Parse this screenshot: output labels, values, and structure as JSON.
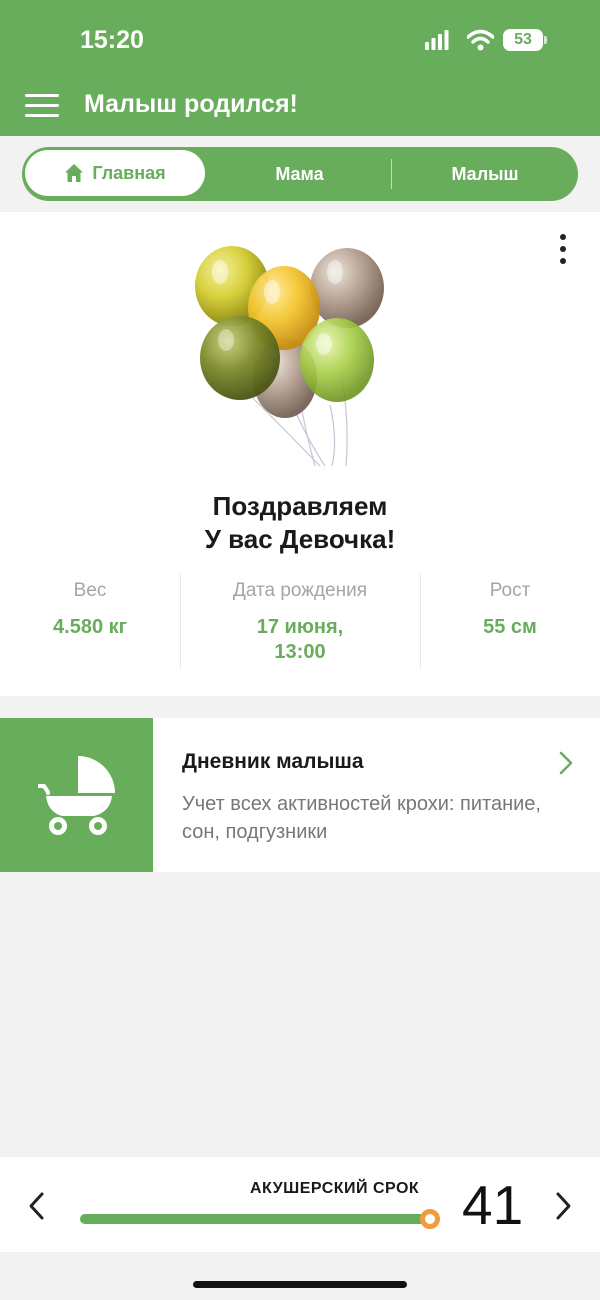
{
  "status_bar": {
    "time": "15:20",
    "battery": "53"
  },
  "header": {
    "title": "Малыш родился!"
  },
  "tabs": [
    {
      "label": "Главная",
      "active": true
    },
    {
      "label": "Мама",
      "active": false
    },
    {
      "label": "Малыш",
      "active": false
    }
  ],
  "congrats": {
    "line1": "Поздравляем",
    "line2": "У вас Девочка!"
  },
  "stats": {
    "weight": {
      "label": "Вес",
      "value": "4.580 кг"
    },
    "birth": {
      "label": "Дата рождения",
      "value_line1": "17 июня,",
      "value_line2": "13:00"
    },
    "height": {
      "label": "Рост",
      "value": "55 см"
    }
  },
  "diary": {
    "title": "Дневник малыша",
    "description": "Учет всех активностей крохи: питание, сон, подгузники"
  },
  "term": {
    "label": "АКУШЕРСКИЙ СРОК",
    "week": "41",
    "progress": 0.99
  },
  "colors": {
    "accent": "#68ad5b",
    "thumb": "#f29b3a"
  }
}
